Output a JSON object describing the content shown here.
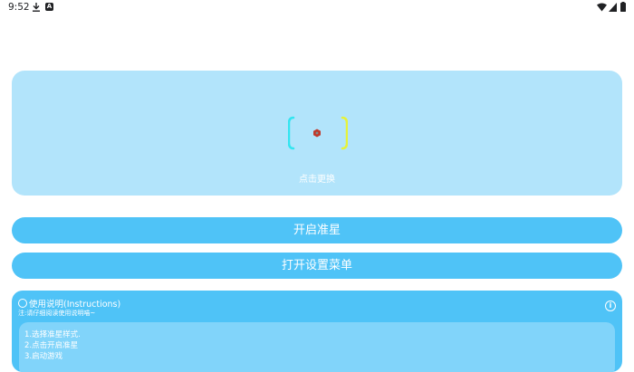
{
  "status_bar": {
    "time": "9:52",
    "icons": [
      "download-icon",
      "app-notification-icon",
      "wifi-icon",
      "signal-icon",
      "battery-icon"
    ]
  },
  "preview": {
    "change_label": "点击更换",
    "crosshair_colors": {
      "left_bracket": "#33e5f0",
      "right_bracket": "#e6f23a",
      "center": "#c0392b"
    }
  },
  "buttons": {
    "start_crosshair": "开启准星",
    "open_settings_menu": "打开设置菜单"
  },
  "instructions": {
    "title": "使用说明(Instructions)",
    "note": "注:请仔细阅读使用说明喵~",
    "steps": [
      "1.选择准星样式.",
      "2.点击开启准星",
      "3.启动游戏"
    ]
  },
  "colors": {
    "accent": "#4fc3f7",
    "preview_bg": "#b2e4fb",
    "instructions_body_bg": "#81d4fa"
  }
}
